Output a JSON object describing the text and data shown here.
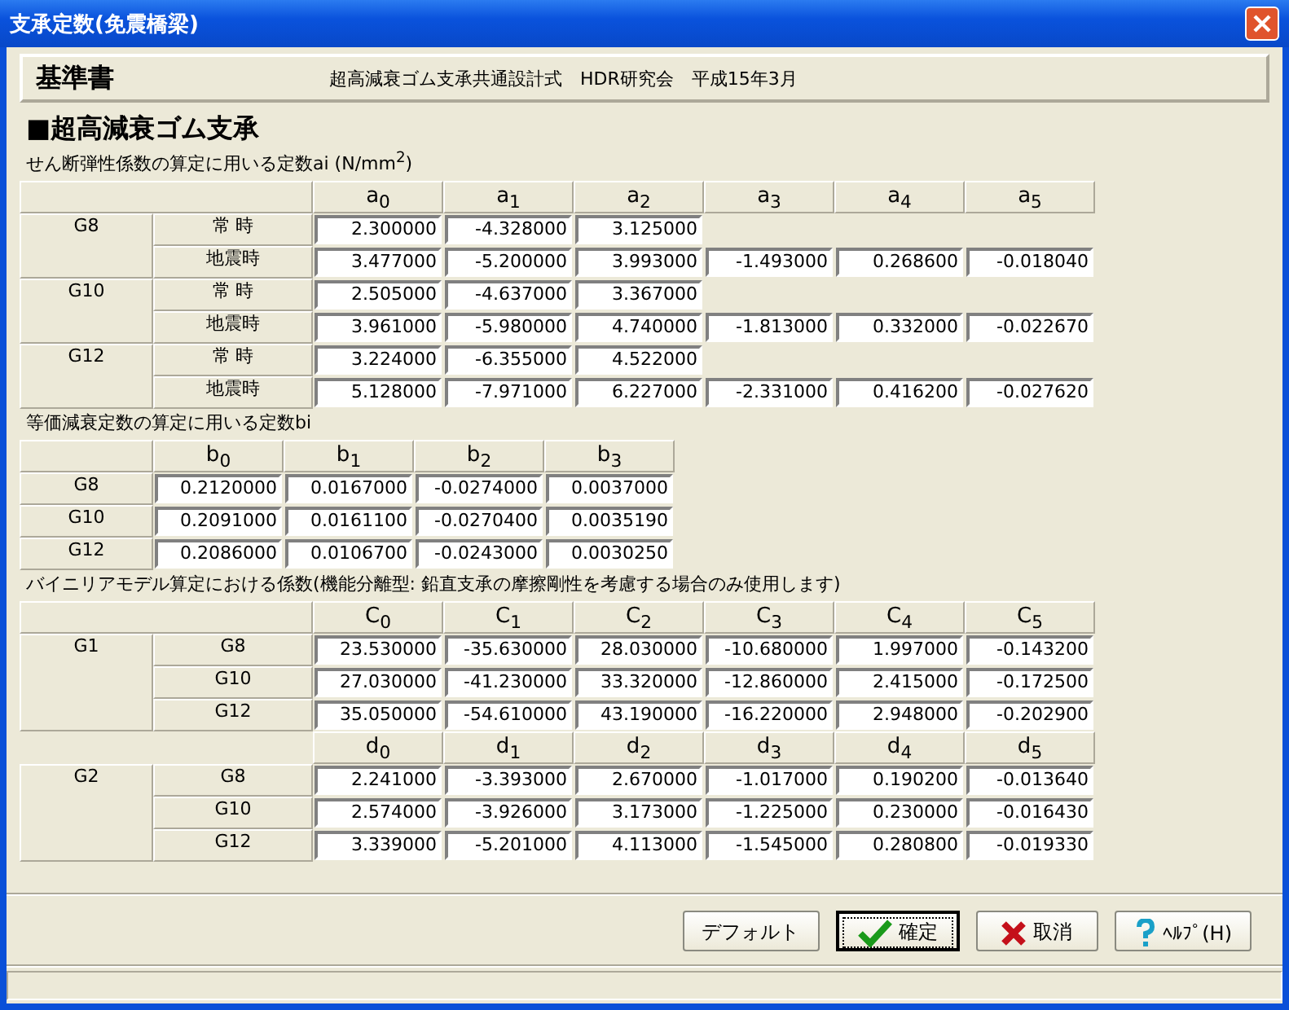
{
  "window": {
    "title": "支承定数(免震橋梁)"
  },
  "header": {
    "label": "基準書",
    "reference": "超高減衰ゴム支承共通設計式　HDR研究会　平成15年3月"
  },
  "section_title": "■超高減衰ゴム支承",
  "table_a": {
    "caption": "せん断弾性係数の算定に用いる定数ai (N/mm$^{2}$)",
    "columns": [
      "a$_{0}$",
      "a$_{1}$",
      "a$_{2}$",
      "a$_{3}$",
      "a$_{4}$",
      "a$_{5}$"
    ],
    "groups": [
      {
        "name": "G8",
        "rows": [
          {
            "label": "常 時",
            "values": [
              "2.300000",
              "-4.328000",
              "3.125000"
            ]
          },
          {
            "label": "地震時",
            "values": [
              "3.477000",
              "-5.200000",
              "3.993000",
              "-1.493000",
              "0.268600",
              "-0.018040"
            ]
          }
        ]
      },
      {
        "name": "G10",
        "rows": [
          {
            "label": "常 時",
            "values": [
              "2.505000",
              "-4.637000",
              "3.367000"
            ]
          },
          {
            "label": "地震時",
            "values": [
              "3.961000",
              "-5.980000",
              "4.740000",
              "-1.813000",
              "0.332000",
              "-0.022670"
            ]
          }
        ]
      },
      {
        "name": "G12",
        "rows": [
          {
            "label": "常 時",
            "values": [
              "3.224000",
              "-6.355000",
              "4.522000"
            ]
          },
          {
            "label": "地震時",
            "values": [
              "5.128000",
              "-7.971000",
              "6.227000",
              "-2.331000",
              "0.416200",
              "-0.027620"
            ]
          }
        ]
      }
    ]
  },
  "table_b": {
    "caption": "等価減衰定数の算定に用いる定数bi",
    "columns": [
      "b$_{0}$",
      "b$_{1}$",
      "b$_{2}$",
      "b$_{3}$"
    ],
    "rows": [
      {
        "label": "G8",
        "values": [
          "0.2120000",
          "0.0167000",
          "-0.0274000",
          "0.0037000"
        ]
      },
      {
        "label": "G10",
        "values": [
          "0.2091000",
          "0.0161100",
          "-0.0270400",
          "0.0035190"
        ]
      },
      {
        "label": "G12",
        "values": [
          "0.2086000",
          "0.0106700",
          "-0.0243000",
          "0.0030250"
        ]
      }
    ]
  },
  "table_c": {
    "caption": "バイニリアモデル算定における係数(機能分離型: 鉛直支承の摩擦剛性を考慮する場合のみ使用します)",
    "blocks": [
      {
        "columns": [
          "C$_{0}$",
          "C$_{1}$",
          "C$_{2}$",
          "C$_{3}$",
          "C$_{4}$",
          "C$_{5}$"
        ],
        "group": "G1",
        "rows": [
          {
            "label": "G8",
            "values": [
              "23.530000",
              "-35.630000",
              "28.030000",
              "-10.680000",
              "1.997000",
              "-0.143200"
            ]
          },
          {
            "label": "G10",
            "values": [
              "27.030000",
              "-41.230000",
              "33.320000",
              "-12.860000",
              "2.415000",
              "-0.172500"
            ]
          },
          {
            "label": "G12",
            "values": [
              "35.050000",
              "-54.610000",
              "43.190000",
              "-16.220000",
              "2.948000",
              "-0.202900"
            ]
          }
        ]
      },
      {
        "columns": [
          "d$_{0}$",
          "d$_{1}$",
          "d$_{2}$",
          "d$_{3}$",
          "d$_{4}$",
          "d$_{5}$"
        ],
        "group": "G2",
        "rows": [
          {
            "label": "G8",
            "values": [
              "2.241000",
              "-3.393000",
              "2.670000",
              "-1.017000",
              "0.190200",
              "-0.013640"
            ]
          },
          {
            "label": "G10",
            "values": [
              "2.574000",
              "-3.926000",
              "3.173000",
              "-1.225000",
              "0.230000",
              "-0.016430"
            ]
          },
          {
            "label": "G12",
            "values": [
              "3.339000",
              "-5.201000",
              "4.113000",
              "-1.545000",
              "0.280800",
              "-0.019330"
            ]
          }
        ]
      }
    ]
  },
  "buttons": [
    {
      "kind": "default",
      "label": "デフォルト",
      "focused": false
    },
    {
      "kind": "ok",
      "label": "確定",
      "focused": true
    },
    {
      "kind": "cancel",
      "label": "取消",
      "focused": false
    },
    {
      "kind": "help",
      "label": "ﾍﾙﾌﾟ(H)",
      "focused": false
    }
  ]
}
